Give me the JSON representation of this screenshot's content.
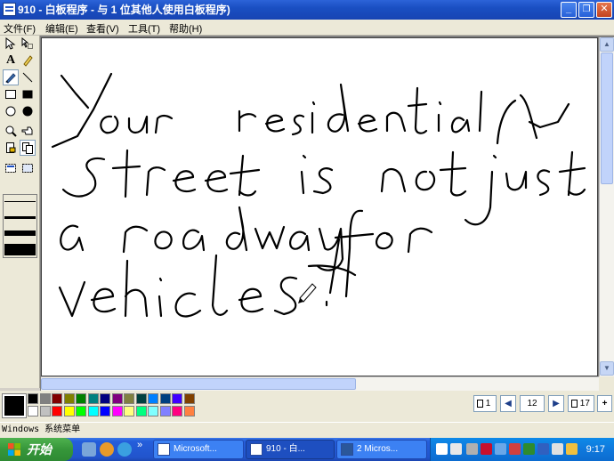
{
  "window": {
    "title": "910 - 白板程序 - 与 1 位其他人使用白板程序)",
    "minimize_label": "_",
    "maximize_label": "❐",
    "close_label": "✕"
  },
  "menu": {
    "items": [
      {
        "label": "文件(F)"
      },
      {
        "label": "编辑(E)"
      },
      {
        "label": "查看(V)"
      },
      {
        "label": "工具(T)"
      },
      {
        "label": "帮助(H)"
      }
    ]
  },
  "toolbox": {
    "tools": [
      {
        "icon": "select-arrow-icon",
        "glyph": "↖"
      },
      {
        "icon": "area-select-icon",
        "glyph": "⬚"
      },
      {
        "icon": "text-tool-icon",
        "glyph": "A"
      },
      {
        "icon": "highlighter-icon",
        "glyph": "✎"
      },
      {
        "icon": "pen-icon",
        "glyph": "✏"
      },
      {
        "icon": "line-icon",
        "glyph": "╲"
      },
      {
        "icon": "rectangle-icon",
        "glyph": "□"
      },
      {
        "icon": "filled-rectangle-icon",
        "glyph": "■"
      },
      {
        "icon": "ellipse-icon",
        "glyph": "○"
      },
      {
        "icon": "filled-ellipse-icon",
        "glyph": "●"
      },
      {
        "icon": "zoom-icon",
        "glyph": "⌕"
      },
      {
        "icon": "remote-pointer-icon",
        "glyph": "☞"
      },
      {
        "icon": "lock-contents-icon",
        "glyph": "⎘"
      },
      {
        "icon": "synchronize-icon",
        "glyph": "⧉"
      },
      {
        "icon": "select-window-icon",
        "glyph": "▣"
      },
      {
        "icon": "select-area-icon",
        "glyph": "▢"
      }
    ],
    "selected_tool": "pen-icon",
    "line_widths": [
      "thin",
      "medium",
      "thick",
      "thicker"
    ]
  },
  "canvas": {
    "handwriting": [
      "Your residential",
      "street is not just",
      "a roadway for",
      "vehicles!"
    ]
  },
  "palette": {
    "current_foreground": "#000000",
    "current_background": "#ffffff",
    "colors_row1": [
      "#000000",
      "#808080",
      "#800000",
      "#808000",
      "#008000",
      "#008080",
      "#000080",
      "#800080",
      "#808040",
      "#004040",
      "#0080ff",
      "#004080",
      "#4000ff",
      "#804000"
    ],
    "colors_row2": [
      "#ffffff",
      "#c0c0c0",
      "#ff0000",
      "#ffff00",
      "#00ff00",
      "#00ffff",
      "#0000ff",
      "#ff00ff",
      "#ffff80",
      "#00ff80",
      "#80ffff",
      "#8080ff",
      "#ff0080",
      "#ff8040"
    ]
  },
  "pages": {
    "first_label": "1",
    "current_page": "12",
    "last_label": "17",
    "add_label": "+"
  },
  "status": {
    "text": "Windows 系统菜单"
  },
  "taskbar": {
    "start_label": "开始",
    "tasks": [
      {
        "label": "Microsoft..."
      },
      {
        "label": "910 - 白..."
      },
      {
        "label": "2 Micros..."
      }
    ],
    "chevron_label": "»",
    "clock": "9:17"
  }
}
